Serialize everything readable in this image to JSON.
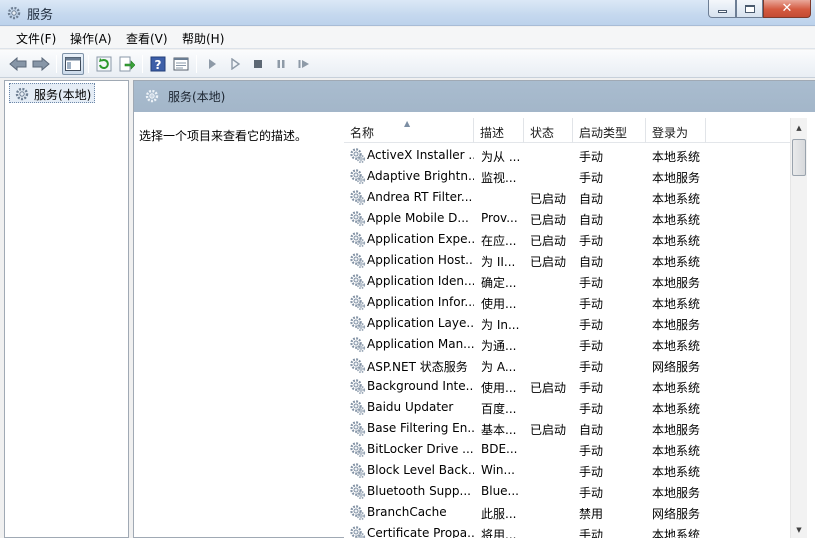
{
  "window": {
    "title": "服务"
  },
  "menu": [
    "文件(F)",
    "操作(A)",
    "查看(V)",
    "帮助(H)"
  ],
  "toolbar": {
    "icons": [
      "back-icon",
      "forward-icon",
      "show-hide-tree-icon",
      "refresh-icon",
      "export-list-icon",
      "help-icon",
      "properties-icon",
      "start-service-icon",
      "start-service-alt-icon",
      "stop-service-icon",
      "pause-service-icon",
      "restart-service-icon"
    ]
  },
  "tree": {
    "node_label": "服务(本地)"
  },
  "content": {
    "header_title": "服务(本地)",
    "description_hint": "选择一个项目来查看它的描述。"
  },
  "list": {
    "columns": {
      "name": "名称",
      "desc": "描述",
      "status": "状态",
      "startup": "启动类型",
      "logon": "登录为"
    },
    "rows": [
      {
        "name": "ActiveX Installer ...",
        "desc": "为从 ...",
        "status": "",
        "startup": "手动",
        "logon": "本地系统"
      },
      {
        "name": "Adaptive Brightn...",
        "desc": "监视...",
        "status": "",
        "startup": "手动",
        "logon": "本地服务"
      },
      {
        "name": "Andrea RT Filter...",
        "desc": "",
        "status": "已启动",
        "startup": "自动",
        "logon": "本地系统"
      },
      {
        "name": "Apple Mobile D...",
        "desc": "Prov...",
        "status": "已启动",
        "startup": "自动",
        "logon": "本地系统"
      },
      {
        "name": "Application Expe...",
        "desc": "在应...",
        "status": "已启动",
        "startup": "手动",
        "logon": "本地系统"
      },
      {
        "name": "Application Host...",
        "desc": "为 II...",
        "status": "已启动",
        "startup": "自动",
        "logon": "本地系统"
      },
      {
        "name": "Application Iden...",
        "desc": "确定...",
        "status": "",
        "startup": "手动",
        "logon": "本地服务"
      },
      {
        "name": "Application Infor...",
        "desc": "使用...",
        "status": "",
        "startup": "手动",
        "logon": "本地系统"
      },
      {
        "name": "Application Laye...",
        "desc": "为 In...",
        "status": "",
        "startup": "手动",
        "logon": "本地服务"
      },
      {
        "name": "Application Man...",
        "desc": "为通...",
        "status": "",
        "startup": "手动",
        "logon": "本地系统"
      },
      {
        "name": "ASP.NET 状态服务",
        "desc": "为 A...",
        "status": "",
        "startup": "手动",
        "logon": "网络服务"
      },
      {
        "name": "Background Inte...",
        "desc": "使用...",
        "status": "已启动",
        "startup": "手动",
        "logon": "本地系统"
      },
      {
        "name": "Baidu Updater",
        "desc": "百度...",
        "status": "",
        "startup": "手动",
        "logon": "本地系统"
      },
      {
        "name": "Base Filtering En...",
        "desc": "基本...",
        "status": "已启动",
        "startup": "自动",
        "logon": "本地服务"
      },
      {
        "name": "BitLocker Drive ...",
        "desc": "BDE...",
        "status": "",
        "startup": "手动",
        "logon": "本地系统"
      },
      {
        "name": "Block Level Back...",
        "desc": "Win...",
        "status": "",
        "startup": "手动",
        "logon": "本地系统"
      },
      {
        "name": "Bluetooth Supp...",
        "desc": "Blue...",
        "status": "",
        "startup": "手动",
        "logon": "本地服务"
      },
      {
        "name": "BranchCache",
        "desc": "此服...",
        "status": "",
        "startup": "禁用",
        "logon": "网络服务"
      },
      {
        "name": "Certificate Propa...",
        "desc": "将用...",
        "status": "",
        "startup": "手动",
        "logon": "本地系统"
      }
    ]
  }
}
